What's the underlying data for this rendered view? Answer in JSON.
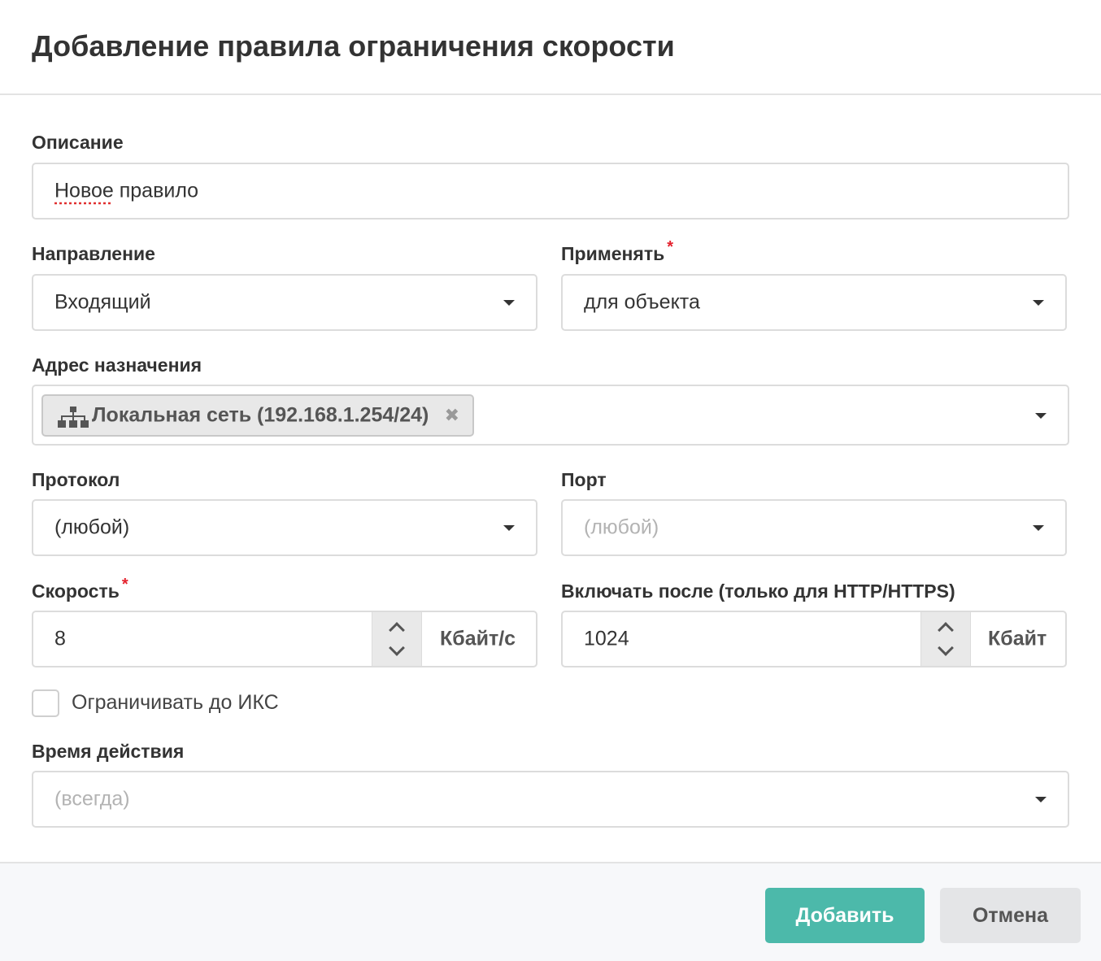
{
  "dialog": {
    "title": "Добавление правила ограничения скорости"
  },
  "form": {
    "description": {
      "label": "Описание",
      "value_word1": "Новое",
      "value_rest": " правило"
    },
    "direction": {
      "label": "Направление",
      "value": "Входящий"
    },
    "apply": {
      "label": "Применять",
      "required_mark": "*",
      "value": "для объекта"
    },
    "destination": {
      "label": "Адрес назначения",
      "tag_icon": "network-icon",
      "tag_text": "Локальная сеть (192.168.1.254/24)",
      "tag_remove": "✖"
    },
    "protocol": {
      "label": "Протокол",
      "value": "(любой)"
    },
    "port": {
      "label": "Порт",
      "placeholder": "(любой)"
    },
    "speed": {
      "label": "Скорость",
      "required_mark": "*",
      "value": "8",
      "unit": "Кбайт/с"
    },
    "enable_after": {
      "label": "Включать после (только для HTTP/HTTPS)",
      "value": "1024",
      "unit": "Кбайт"
    },
    "limit_to_ics": {
      "label": "Ограничивать до ИКС",
      "checked": false
    },
    "schedule": {
      "label": "Время действия",
      "placeholder": "(всегда)"
    }
  },
  "footer": {
    "add_label": "Добавить",
    "cancel_label": "Отмена"
  },
  "colors": {
    "primary": "#4cb9aa",
    "required": "#e4212d",
    "border": "#dcdcdc"
  }
}
